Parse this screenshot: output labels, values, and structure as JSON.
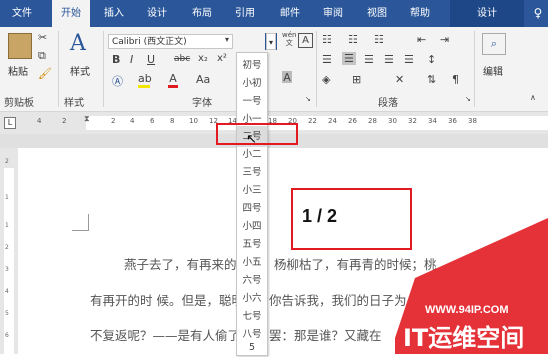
{
  "tabs": [
    {
      "label": "文件"
    },
    {
      "label": "开始"
    },
    {
      "label": "插入"
    },
    {
      "label": "设计"
    },
    {
      "label": "布局"
    },
    {
      "label": "引用"
    },
    {
      "label": "邮件"
    },
    {
      "label": "审阅"
    },
    {
      "label": "视图"
    },
    {
      "label": "帮助"
    },
    {
      "label": "设计"
    }
  ],
  "clipboard": {
    "paste": "粘贴",
    "group": "剪贴板"
  },
  "styles": {
    "label": "样式",
    "group": "样式"
  },
  "font": {
    "name": "Calibri (西文正文)",
    "group": "字体",
    "wen": "wén",
    "bold": "B",
    "italic": "I",
    "underline": "U",
    "strike": "abc",
    "sub": "x₂",
    "sup": "x²",
    "aa": "Aa"
  },
  "paragraph": {
    "group": "段落"
  },
  "editing": {
    "label": "编辑"
  },
  "ruler_marks": [
    "4",
    "2",
    "2",
    "4",
    "6",
    "8",
    "10",
    "12",
    "14",
    "16",
    "18",
    "20",
    "22",
    "24",
    "26",
    "28",
    "30",
    "32",
    "34",
    "36",
    "38"
  ],
  "vruler_marks": [
    "2",
    "1",
    "1",
    "2",
    "3",
    "4",
    "5",
    "6",
    "7",
    "8",
    "9",
    "10"
  ],
  "font_sizes": [
    "初号",
    "小初",
    "一号",
    "小一",
    "二号",
    "小二",
    "三号",
    "小三",
    "四号",
    "小四",
    "五号",
    "小五",
    "六号",
    "小六",
    "七号",
    "八号",
    "5"
  ],
  "page_indicator": "1 / 2",
  "document_lines": [
    "燕子去了，有再来的时候；杨柳枯了，有再青的时候；桃",
    "有再开的时 候。但是，聪明的，你告诉我，我们的日子为",
    "不复返呢？——是有人偷了他 们罢：那是谁？又藏在"
  ],
  "watermark": {
    "url": "WWW.94IP.COM",
    "brand": "IT运维空间"
  },
  "colors": {
    "ribbon_blue": "#2b579a",
    "highlight_red": "#e21b22",
    "watermark_red": "#e21b22"
  }
}
